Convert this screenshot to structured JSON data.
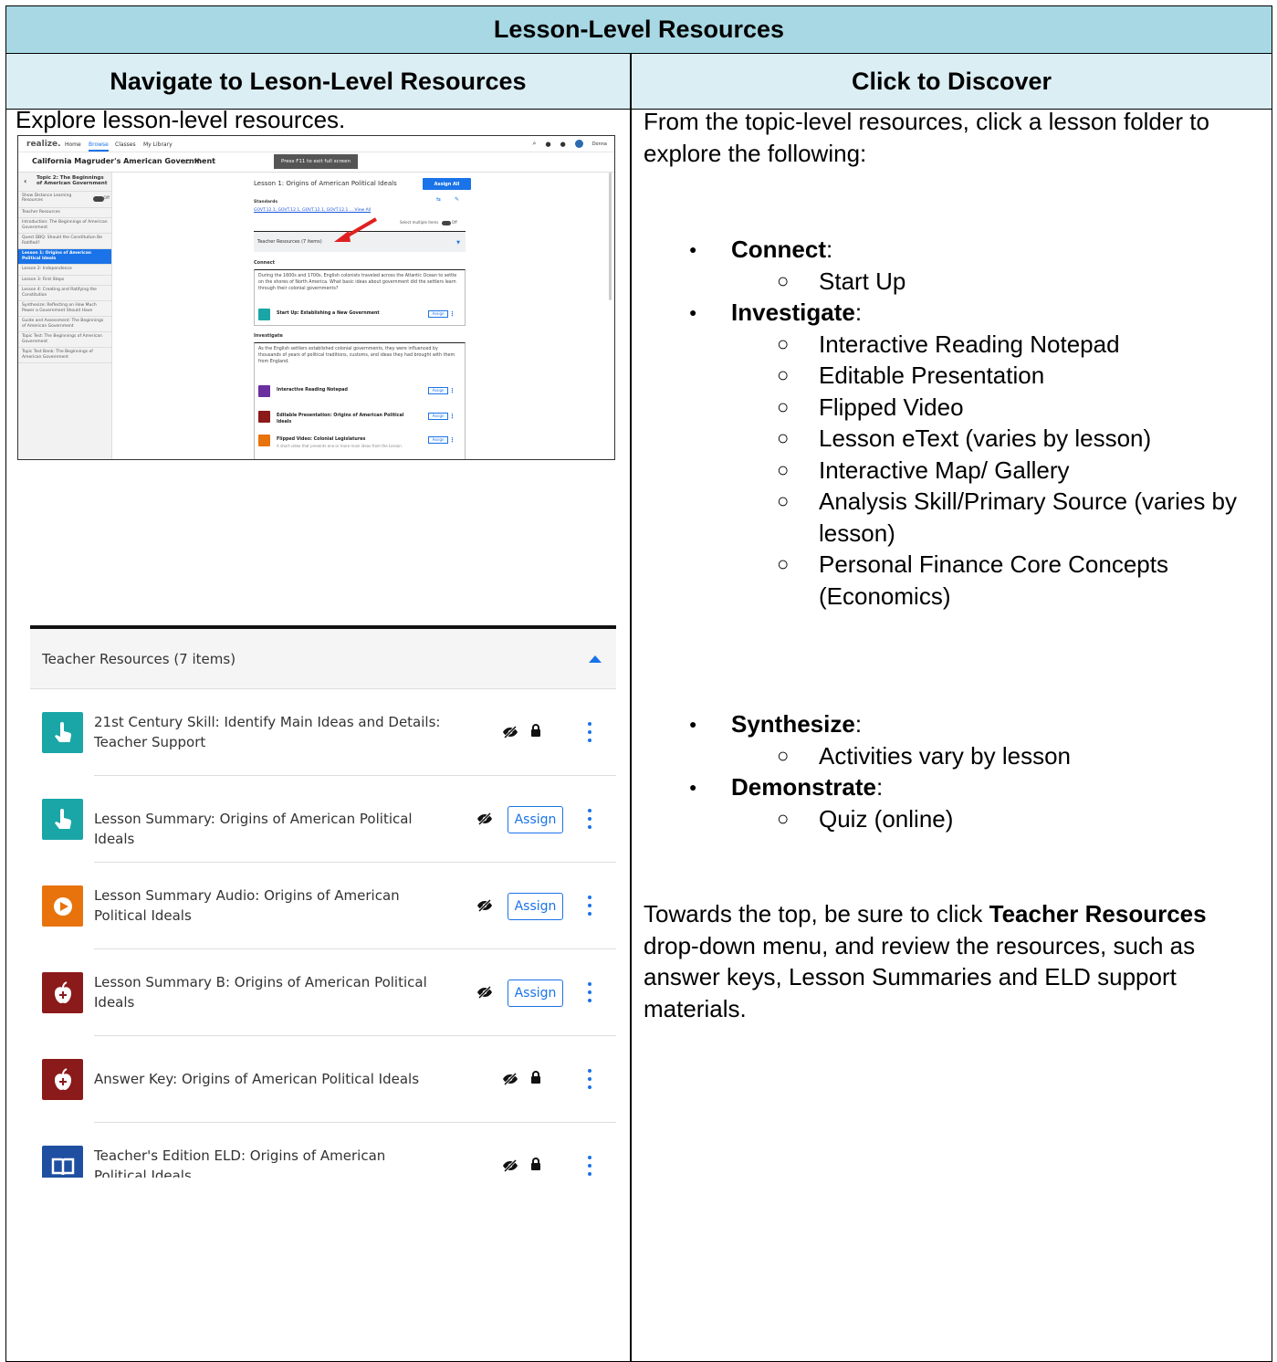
{
  "title": "Lesson-Level Resources",
  "headers": {
    "left": "Navigate to Leson-Level Resources",
    "right": "Click to Discover"
  },
  "left": {
    "intro": "Explore lesson-level resources.",
    "screenshot1": {
      "nav": {
        "logo": "realize.",
        "links": [
          "Home",
          "Browse",
          "Classes",
          "My Library"
        ],
        "user": "Donna"
      },
      "program": "California Magruder's American Government",
      "fullscreen_hint": "Press F11 to exit full screen",
      "sidebar": {
        "topic": "Topic 2: The Beginnings of American Government",
        "toggle_label": "Show Distance Learning Resources",
        "toggle_state": "Off",
        "items": [
          "Teacher Resources",
          "Introduction: The Beginnings of American Government",
          "Quest DBQ: Should the Constitution Be Ratified?",
          "Lesson 1: Origins of American Political Ideals",
          "Lesson 2: Independence",
          "Lesson 3: First Steps",
          "Lesson 4: Creating and Ratifying the Constitution",
          "Synthesize: Reflecting on How Much Power a Government Should Have",
          "Guide and Assessment: The Beginnings of American Government",
          "Topic Test: The Beginnings of American Government",
          "Topic Test Bank: The Beginnings of American Government"
        ],
        "active_index": 3
      },
      "lesson_title": "Lesson 1: Origins of American Political Ideals",
      "assign_all": "Assign All",
      "standards_label": "Standards",
      "standards_links": "GOVT.12.1, GOVT.12.1, GOVT.12.1, GOVT.12.1 ... View All",
      "select_multiple": "Select multiple items",
      "select_multiple_state": "Off",
      "teacher_resources": "Teacher Resources (7 items)",
      "connect_label": "Connect",
      "connect_text": "During the 1600s and 1700s, English colonists traveled across the Atlantic Ocean to settle on the shores of North America. What basic ideas about government did the settlers learn through their colonial governments?",
      "connect_item": "Start Up: Establishing a New Government",
      "investigate_label": "Investigate",
      "investigate_text": "As the English settlers established colonial governments, they were influenced by thousands of years of political traditions, customs, and ideas they had brought with them from England.",
      "investigate_items": [
        {
          "name": "Interactive Reading Notepad",
          "color": "#6b2fa0"
        },
        {
          "name": "Editable Presentation: Origins of American Political Ideals",
          "color": "#8b1a1a"
        },
        {
          "name": "Flipped Video: Colonial Legislatures",
          "color": "#e8730c",
          "desc": "A short video that presents one or more main ideas from the Lesson."
        }
      ],
      "assign_label": "Assign"
    },
    "screenshot2": {
      "header": "Teacher Resources (7 items)",
      "items": [
        {
          "label": "21st Century Skill: Identify Main Ideas and Details: Teacher Support",
          "icon": "hand-pointer-icon",
          "color": "#1aa6a6",
          "assignable": false
        },
        {
          "label": "Lesson Summary: Origins of American Political Ideals",
          "icon": "hand-pointer-icon",
          "color": "#1aa6a6",
          "assignable": true
        },
        {
          "label": "Lesson Summary Audio: Origins of American Political Ideals",
          "icon": "play-icon",
          "color": "#e8730c",
          "assignable": true
        },
        {
          "label": "Lesson Summary B: Origins of American Political Ideals",
          "icon": "apple-icon",
          "color": "#8b1a1a",
          "assignable": true
        },
        {
          "label": "Answer Key: Origins of American Political Ideals",
          "icon": "apple-icon",
          "color": "#8b1a1a",
          "assignable": false
        },
        {
          "label": "Teacher's Edition ELD: Origins of American Political Ideals",
          "icon": "book-icon",
          "color": "#1f4fa0",
          "assignable": false
        }
      ],
      "assign_label": "Assign"
    }
  },
  "right": {
    "intro": "From the topic-level resources, click a lesson folder to explore the following:",
    "groups1": [
      {
        "label": "Connect",
        "items": [
          "Start Up"
        ]
      },
      {
        "label": "Investigate",
        "items": [
          "Interactive Reading Notepad",
          "Editable Presentation",
          "Flipped Video",
          "Lesson eText (varies by lesson)",
          "Interactive Map/ Gallery",
          "Analysis Skill/Primary Source (varies by lesson)",
          "Personal Finance Core Concepts (Economics)"
        ]
      }
    ],
    "groups2": [
      {
        "label": "Synthesize",
        "items": [
          "Activities vary by lesson"
        ]
      },
      {
        "label": "Demonstrate",
        "items": [
          "Quiz (online)"
        ]
      }
    ],
    "outro": {
      "before": "Towards the top, be sure to click ",
      "bold": "Teacher Resources",
      "after": " drop-down menu, and review the resources, such as answer keys, Lesson Summaries and ELD support materials."
    }
  }
}
